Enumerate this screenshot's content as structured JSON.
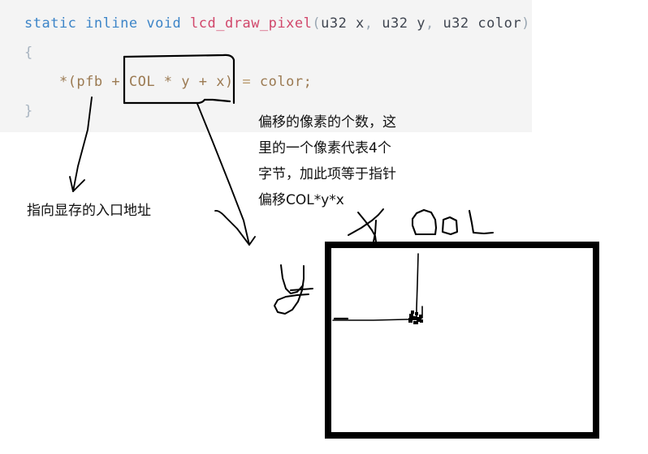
{
  "code_block": {
    "language": "c",
    "background": "#f4f4f4",
    "lines": [
      {
        "id": "signature",
        "tokens": [
          {
            "text": "static",
            "kind": "keyword",
            "color": "#3d85c8"
          },
          {
            "text": " ",
            "kind": "space"
          },
          {
            "text": "inline",
            "kind": "keyword",
            "color": "#3d85c8"
          },
          {
            "text": " ",
            "kind": "space"
          },
          {
            "text": "void",
            "kind": "keyword",
            "color": "#3d85c8"
          },
          {
            "text": " ",
            "kind": "space"
          },
          {
            "text": "lcd_draw_pixel",
            "kind": "function",
            "color": "#d1476b"
          },
          {
            "text": "(",
            "kind": "punct",
            "color": "#9aa7b3"
          },
          {
            "text": "u32 x",
            "kind": "param",
            "color": "#3f4550"
          },
          {
            "text": ", ",
            "kind": "punct",
            "color": "#9aa7b3"
          },
          {
            "text": "u32 y",
            "kind": "param",
            "color": "#3f4550"
          },
          {
            "text": ", ",
            "kind": "punct",
            "color": "#9aa7b3"
          },
          {
            "text": "u32 color",
            "kind": "param",
            "color": "#3f4550"
          },
          {
            "text": ")",
            "kind": "punct",
            "color": "#9aa7b3"
          }
        ]
      },
      {
        "id": "open-brace",
        "tokens": [
          {
            "text": "{",
            "kind": "brace",
            "color": "#a8b4c0"
          }
        ]
      },
      {
        "id": "assignment",
        "tokens": [
          {
            "text": "    ",
            "kind": "space"
          },
          {
            "text": "*(pfb + ",
            "kind": "expr",
            "color": "#9b7a52"
          },
          {
            "text": "COL * y + x)",
            "kind": "expr",
            "color": "#9b7a52"
          },
          {
            "text": " = ",
            "kind": "op",
            "color": "#9b7a52"
          },
          {
            "text": "color;",
            "kind": "expr",
            "color": "#9b7a52"
          }
        ]
      },
      {
        "id": "close-brace",
        "tokens": [
          {
            "text": "}",
            "kind": "brace",
            "color": "#a8b4c0"
          }
        ]
      }
    ],
    "plain_text": "static inline void lcd_draw_pixel(u32 x, u32 y, u32 color)\n{\n    *(pfb + COL * y + x) = color;\n}"
  },
  "annotations": {
    "right_note": {
      "lines": [
        "偏移的像素的个数，这",
        "里的一个像素代表4个",
        "字节，加此项等于指针",
        "偏移COL*y*x"
      ],
      "full_text": "偏移的像素的个数，这里的一个像素代表4个字节，加此项等于指针偏移COL*y*x",
      "color": "#111111"
    },
    "left_note": {
      "text": "指向显存的入口地址",
      "color": "#111111"
    }
  },
  "sketch": {
    "ink_color": "#000000",
    "box_around_expression": {
      "target_text": "COL * y + x)",
      "label": "highlight-box"
    },
    "arrow_to_left_note": {
      "from": "pfb",
      "to": "指向显存的入口地址"
    },
    "arrow_to_right_note": {
      "from": "COL * y + x)",
      "to": "偏移COL*y*x"
    },
    "axis_labels": {
      "x_label": "x",
      "y_label": "y",
      "col_label": "COL"
    },
    "screen_rect": {
      "label": "framebuffer-screen-rectangle",
      "border_color": "#000000",
      "border_width": 8
    },
    "pixel_marker": {
      "label": "pixel-point",
      "color": "#000000"
    }
  }
}
